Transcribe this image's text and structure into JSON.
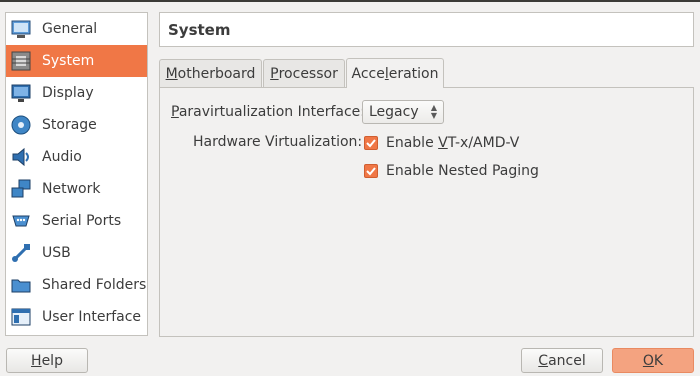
{
  "header": {
    "title": "System"
  },
  "sidebar": {
    "items": [
      {
        "label": "General",
        "icon": "general-icon"
      },
      {
        "label": "System",
        "icon": "system-chip-icon",
        "selected": true
      },
      {
        "label": "Display",
        "icon": "display-icon"
      },
      {
        "label": "Storage",
        "icon": "storage-icon"
      },
      {
        "label": "Audio",
        "icon": "audio-icon"
      },
      {
        "label": "Network",
        "icon": "network-icon"
      },
      {
        "label": "Serial Ports",
        "icon": "serial-ports-icon"
      },
      {
        "label": "USB",
        "icon": "usb-icon"
      },
      {
        "label": "Shared Folders",
        "icon": "shared-folders-icon"
      },
      {
        "label": "User Interface",
        "icon": "user-interface-icon"
      }
    ]
  },
  "tabs": [
    {
      "label": "Motherboard",
      "underline": "M",
      "rest": "otherboard"
    },
    {
      "label": "Processor",
      "underline": "P",
      "rest": "rocessor"
    },
    {
      "label": "Acceleration",
      "pre": "Acce",
      "underline": "l",
      "rest": "eration",
      "active": true
    }
  ],
  "form": {
    "paravirt_label": {
      "underline": "P",
      "rest": "aravirtualization Interface:"
    },
    "paravirt_value": "Legacy",
    "hwvirt_label": "Hardware Virtualization:",
    "vtx": {
      "pre": "Enable ",
      "underline": "V",
      "rest": "T-x/AMD-V",
      "checked": true
    },
    "nested": {
      "pre": "Enable Nested Pa",
      "underline": "g",
      "rest": "ing",
      "checked": true
    }
  },
  "buttons": {
    "help": {
      "underline": "H",
      "rest": "elp"
    },
    "cancel": {
      "underline": "C",
      "rest": "ancel"
    },
    "ok": {
      "underline": "O",
      "rest": "K"
    }
  },
  "colors": {
    "accent": "#f07746",
    "ok_button": "#f4a380"
  }
}
